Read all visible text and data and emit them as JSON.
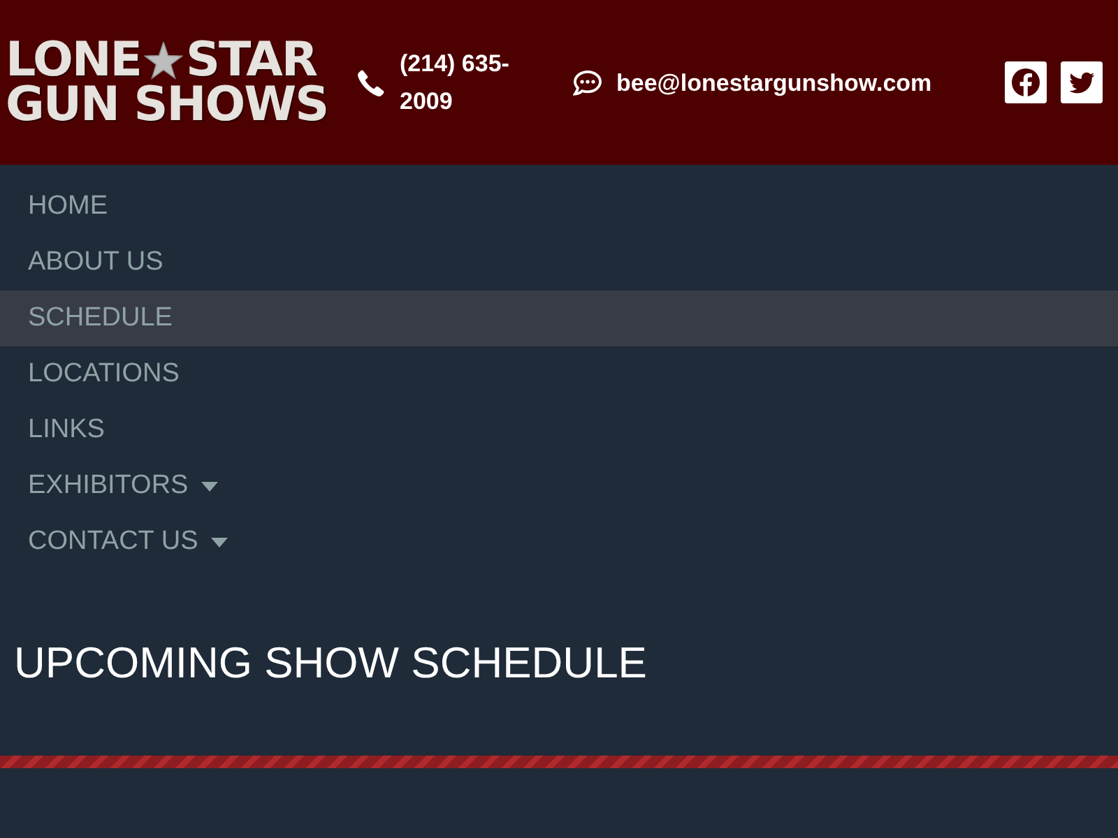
{
  "header": {
    "logo": {
      "top_left": "LONE",
      "top_right": "STAR",
      "bottom": "GUN SHOWS"
    },
    "phone": "(214) 635-2009",
    "email": "bee@lonestargunshow.com"
  },
  "nav": {
    "items": [
      {
        "label": "HOME",
        "selected": false,
        "submenu": false
      },
      {
        "label": "ABOUT US",
        "selected": false,
        "submenu": false
      },
      {
        "label": "SCHEDULE",
        "selected": true,
        "submenu": false
      },
      {
        "label": "LOCATIONS",
        "selected": false,
        "submenu": false
      },
      {
        "label": "LINKS",
        "selected": false,
        "submenu": false
      },
      {
        "label": "EXHIBITORS",
        "selected": false,
        "submenu": true
      },
      {
        "label": "CONTACT US",
        "selected": false,
        "submenu": true
      }
    ]
  },
  "main": {
    "heading": "UPCOMING SHOW SCHEDULE"
  }
}
